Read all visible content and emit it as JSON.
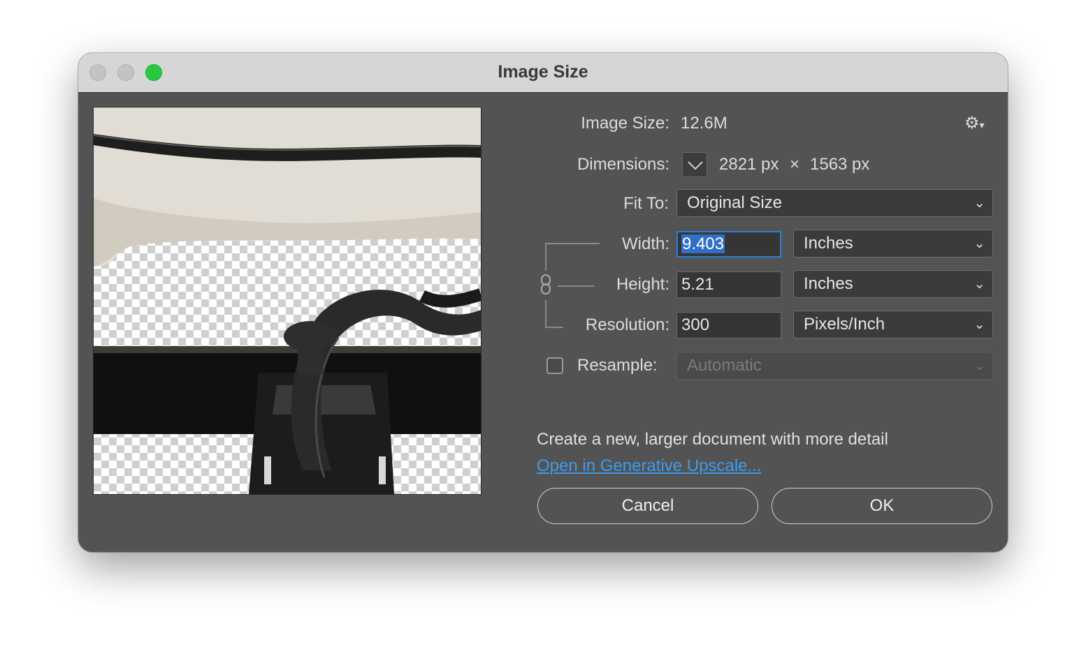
{
  "window": {
    "title": "Image Size"
  },
  "image_size": {
    "label": "Image Size:",
    "value": "12.6M"
  },
  "dimensions": {
    "label": "Dimensions:",
    "width": "2821 px",
    "times": "×",
    "height": "1563 px"
  },
  "fit_to": {
    "label": "Fit To:",
    "value": "Original Size"
  },
  "width": {
    "label": "Width:",
    "value": "9.403",
    "unit": "Inches"
  },
  "height": {
    "label": "Height:",
    "value": "5.21",
    "unit": "Inches"
  },
  "resolution": {
    "label": "Resolution:",
    "value": "300",
    "unit": "Pixels/Inch"
  },
  "resample": {
    "label": "Resample:",
    "value": "Automatic",
    "checked": false
  },
  "footer": {
    "info": "Create a new, larger document with more detail",
    "link": "Open in Generative Upscale...",
    "cancel": "Cancel",
    "ok": "OK"
  },
  "icons": [
    "gear-icon",
    "chevron-down-icon",
    "link-chain-icon"
  ]
}
